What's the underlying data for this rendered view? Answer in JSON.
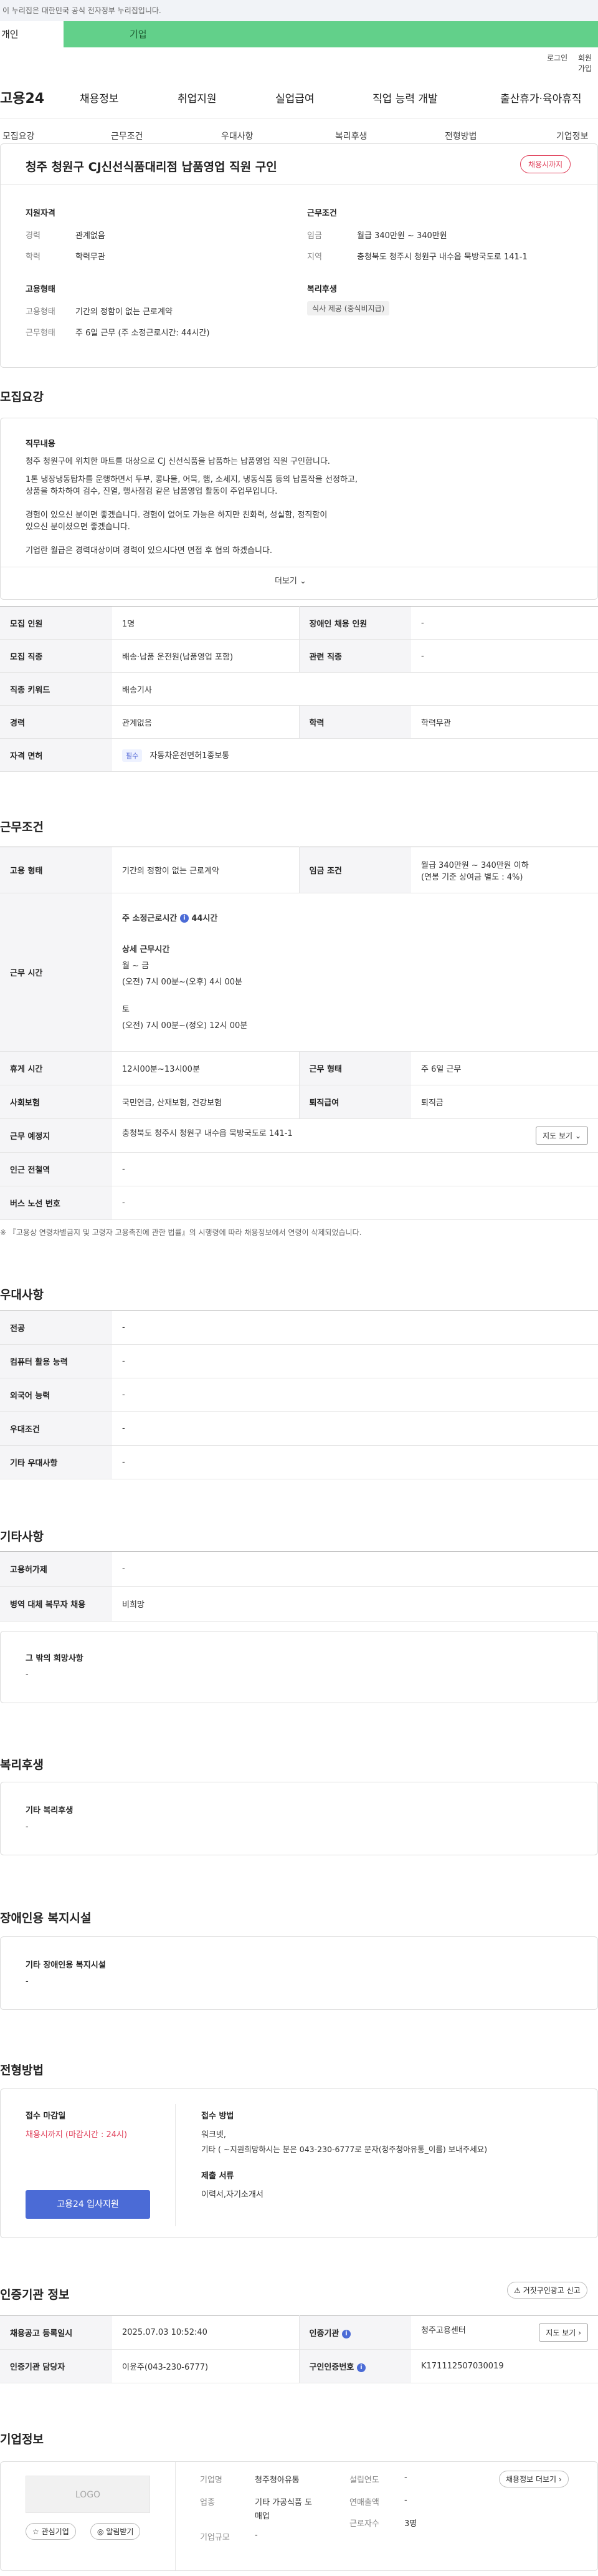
{
  "gov_banner": "이 누리집은 대한민국 공식 전자정부 누리집입니다.",
  "top_tabs": {
    "individual": "개인",
    "corporate": "기업"
  },
  "utility": {
    "login": "로그인",
    "signup": "회원가입"
  },
  "gnb": {
    "logo": "고용24",
    "items": [
      "채용정보",
      "취업지원",
      "실업급여",
      "직업 능력 개발",
      "출산휴가·육아휴직"
    ]
  },
  "snb": {
    "items": [
      "모집요강",
      "근무조건",
      "우대사항",
      "복리후생",
      "전형방법",
      "기업정보"
    ]
  },
  "header": {
    "title": "청주 청원구 CJ신선식품대리점 납품영업 직원 구인",
    "status": "채용시까지",
    "qualification_title": "지원자격",
    "qualification": [
      {
        "k": "경력",
        "v": "관계없음"
      },
      {
        "k": "학력",
        "v": "학력무관"
      }
    ],
    "conditions_title": "근무조건",
    "conditions": [
      {
        "k": "임금",
        "v": "월급 340만원 ~ 340만원"
      },
      {
        "k": "지역",
        "v": "충청북도 청주시 청원구 내수읍 묵방국도로 141-1"
      }
    ],
    "employment_title": "고용형태",
    "employment": [
      {
        "k": "고용형태",
        "v": "기간의 정함이 없는 근로계약"
      },
      {
        "k": "근무형태",
        "v": "주 6일 근무 (주 소정근로시간: 44시간)"
      }
    ],
    "welfare_title": "복리후생",
    "welfare_chip": "식사 제공 (중식비지급)"
  },
  "recruit": {
    "section_title": "모집요강",
    "duty_title": "직무내용",
    "duty_lines": [
      "청주 청원구에 위치한 마트를 대상으로 CJ 신선식품을 납품하는 납품영업 직원 구인합니다.",
      "1톤 냉장냉동탑차를 운행하면서 두부, 콩나물, 어묵, 햄, 소세지, 냉동식품 등의 납품작을 선정하고,",
      "상품을 하차하여 검수, 진열, 행사점검 같은 납품영업 활동이 주업무입니다.",
      "",
      "경험이 있으신 분이면 좋겠습니다. 경험이 없어도 가능은 하지만 친화력, 성실함, 정직함이",
      "있으신 분이셨으면 좋겠습니다.",
      "",
      "기업란 월급은 경력대상이며 경력이 있으시다면 면접 후 협의 하겠습니다."
    ],
    "more": "더보기",
    "rows": [
      {
        "th1": "모집 인원",
        "td1": "1명",
        "th2": "장애인 채용 인원",
        "td2": "-"
      },
      {
        "th1": "모집 직종",
        "td1": "배송·납품 운전원(납품영업 포함)",
        "th2": "관련 직종",
        "td2": "-"
      },
      {
        "th1": "직종 키워드",
        "td1": "배송기사"
      },
      {
        "th1": "경력",
        "td1": "관계없음",
        "th2": "학력",
        "td2": "학력무관"
      },
      {
        "th1": "자격 면허",
        "chip": "필수",
        "td1": "자동차운전면허1종보통"
      }
    ]
  },
  "work": {
    "section_title": "근무조건",
    "employment_th": "고용 형태",
    "employment_td": "기간의 정함이 없는 근로계약",
    "wage_th": "임금 조건",
    "wage_td1": "월급 340만원 ~ 340만원 이하",
    "wage_td2": "(연봉 기준 상여금 별도 : 4%)",
    "hours_th": "근무 시간",
    "hours_weekly_label": "주 소정근로시간",
    "hours_weekly_value": "44시간",
    "hours_detail_title": "상세 근무시간",
    "hours_lines": [
      "월 ~ 금",
      "(오전) 7시 00분~(오후) 4시 00분",
      "",
      "토",
      "(오전) 7시 00분~(정오) 12시 00분"
    ],
    "break_th": "휴게 시간",
    "break_td": "12시00분~13시00분",
    "worktype_th": "근무 형태",
    "worktype_td": "주 6일 근무",
    "insurance_th": "사회보험",
    "insurance_td": "국민연금, 산재보험, 건강보험",
    "retire_th": "퇴직급여",
    "retire_td": "퇴직금",
    "place_th": "근무 예정지",
    "place_td": "충청북도 청주시 청원구 내수읍 묵방국도로 141-1",
    "map_btn": "지도 보기",
    "subway_th": "인근 전철역",
    "subway_td": "-",
    "bus_th": "버스 노선 번호",
    "bus_td": "-",
    "note": "※ 『고용상 연령차별금지 및 고령자 고용촉진에 관한 법률』의 시행령에 따라 채용정보에서 연령이 삭제되었습니다."
  },
  "pref": {
    "section_title": "우대사항",
    "rows": [
      {
        "th": "전공",
        "td": "-"
      },
      {
        "th": "컴퓨터 활용 능력",
        "td": "-"
      },
      {
        "th": "외국어 능력",
        "td": "-"
      },
      {
        "th": "우대조건",
        "td": "-"
      },
      {
        "th": "기타 우대사항",
        "td": "-"
      }
    ]
  },
  "etc": {
    "section_title": "기타사항",
    "rows": [
      {
        "th": "고용허가제",
        "td": "-"
      },
      {
        "th": "병역 대체 복무자 채용",
        "td": "비희망"
      }
    ],
    "hope_title": "그 밖의 희망사항",
    "hope_value": "-"
  },
  "welfare": {
    "section_title": "복리후생",
    "box_title": "기타 복리후생",
    "box_value": "-"
  },
  "disabled": {
    "section_title": "장애인용 복지시설",
    "box_title": "기타 장애인용 복지시설",
    "box_value": "-"
  },
  "process": {
    "section_title": "전형방법",
    "deadline_label": "접수 마감일",
    "deadline_value": "채용시까지 (마감시간 : 24시)",
    "apply_btn": "고용24 입사지원",
    "method_label": "접수 방법",
    "method_line1": "워크넷,",
    "method_line2": "기타 ( ~지원희망하시는 분은 043-230-6777로 문자(청주청아유통_이름) 보내주세요)",
    "docs_label": "제출 서류",
    "docs_value": "이력서,자기소개서"
  },
  "cert": {
    "section_title": "인증기관 정보",
    "report_btn": "거짓구인광고 신고",
    "reg_date_th": "채용공고 등록일시",
    "reg_date_td": "2025.07.03 10:52:40",
    "agency_th": "인증기관",
    "agency_td": "청주고용센터",
    "map_btn": "지도 보기",
    "manager_th": "인증기관 담당자",
    "manager_td": "이윤주(043-230-6777)",
    "no_th": "구인인증번호",
    "no_td": "K171112507030019"
  },
  "company": {
    "section_title": "기업정보",
    "logo_text": "LOGO",
    "fav_btn": "관심기업",
    "alarm_btn": "알림받기",
    "more_btn": "채용정보 더보기",
    "name_k": "기업명",
    "name_v": "청주청아유통",
    "found_k": "설립연도",
    "found_v": "-",
    "biz_k": "업종",
    "biz_v1": "기타 가공식품 도",
    "biz_v2": "매업",
    "sales_k": "연매출액",
    "sales_v": "-",
    "emp_k": "근로자수",
    "emp_v": "3명",
    "size_k": "기업규모",
    "size_v": "-"
  }
}
